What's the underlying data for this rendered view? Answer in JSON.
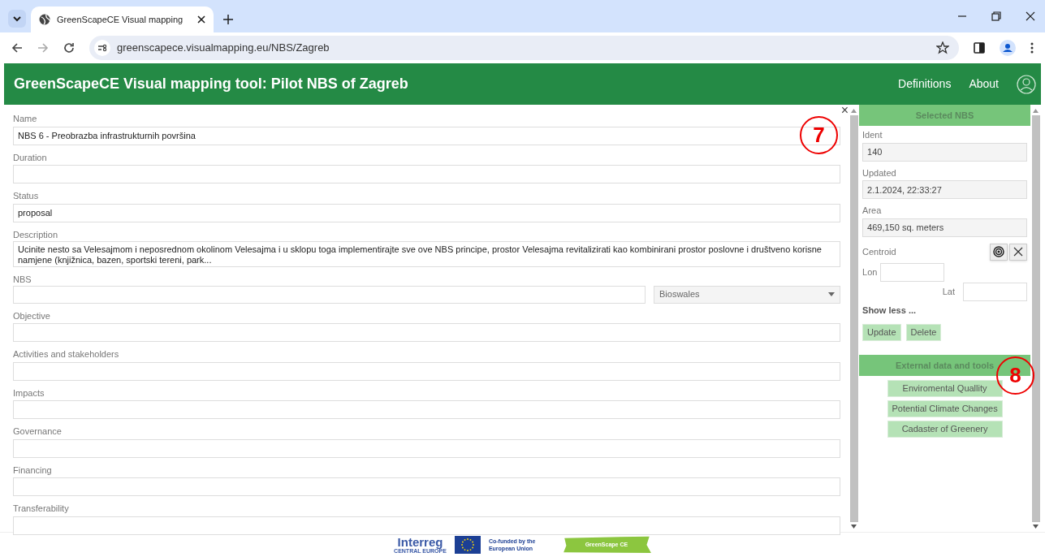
{
  "browser": {
    "tab_title": "GreenScapeCE Visual mapping",
    "url": "greenscapece.visualmapping.eu/NBS/Zagreb"
  },
  "header": {
    "title": "GreenScapeCE Visual mapping tool: Pilot NBS of Zagreb",
    "links": [
      "Definitions",
      "About"
    ]
  },
  "form": {
    "close": "×",
    "fields": [
      {
        "kind": "text",
        "label": "Name",
        "value": "NBS 6 - Preobrazba infrastrukturnih površina"
      },
      {
        "kind": "text",
        "label": "Duration"
      },
      {
        "kind": "text",
        "label": "Status",
        "value": "proposal"
      },
      {
        "kind": "textarea",
        "label": "Description",
        "value": "Ucinite nesto sa Velesajmom i neposrednom okolinom Velesajma i u sklopu toga implementirajte sve ove NBS principe, prostor Velesajma revitalizirati kao kombinirani prostor poslovne i društveno korisne namjene (knjižnica, bazen, sportski tereni, park..."
      },
      {
        "kind": "select",
        "label": "NBS",
        "option": "Bioswales"
      },
      {
        "kind": "text",
        "label": "Objective"
      },
      {
        "kind": "text",
        "label": "Activities and stakeholders"
      },
      {
        "kind": "text",
        "label": "Impacts"
      },
      {
        "kind": "text",
        "label": "Governance"
      },
      {
        "kind": "text",
        "label": "Financing"
      },
      {
        "kind": "text",
        "label": "Transferability"
      }
    ]
  },
  "selected_nbs": {
    "title": "Selected NBS",
    "fields": [
      {
        "label": "Ident",
        "value": "140"
      },
      {
        "label": "Updated",
        "value": "2.1.2024, 22:33:27"
      },
      {
        "label": "Area",
        "value": "469,150 sq. meters"
      }
    ],
    "centroid": {
      "label": "Centroid",
      "lon_label": "Lon",
      "lat_label": "Lat"
    },
    "toggle": "Show less ...",
    "buttons": [
      "Update",
      "Delete"
    ]
  },
  "external": {
    "title": "External data and tools",
    "buttons": [
      "Enviromental Quallity",
      "Potential Climate Changes",
      "Cadaster of Greenery"
    ]
  },
  "footer": {
    "interreg": "Interreg",
    "region": "CENTRAL EUROPE",
    "eu_text": "Co-funded by the European Union",
    "project": "GreenScape CE"
  },
  "annotations": [
    "7",
    "8"
  ]
}
